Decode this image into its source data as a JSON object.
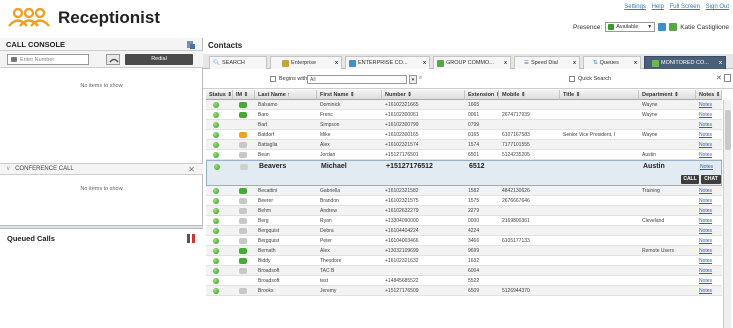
{
  "app": {
    "title": "Receptionist"
  },
  "header": {
    "links": [
      "Settings",
      "Help",
      "Full Screen",
      "Sign Out"
    ],
    "presence_label": "Presence:",
    "presence_value": "Available",
    "user_name": "Katie Castiglione"
  },
  "call_console": {
    "title": "CALL CONSOLE",
    "enter_number_placeholder": "Enter Number",
    "redial_label": "Redial",
    "no_items": "No items to show"
  },
  "conference": {
    "title": "CONFERENCE CALL",
    "no_items": "No items to show"
  },
  "queued": {
    "title": "Queued Calls"
  },
  "contacts": {
    "title": "Contacts",
    "tabs": [
      {
        "label": "SEARCH",
        "closable": false
      },
      {
        "label": "Enterprise",
        "closable": true
      },
      {
        "label": "ENTERPRISE CO...",
        "closable": true
      },
      {
        "label": "GROUP COMMO...",
        "closable": true
      },
      {
        "label": "Speed Dial",
        "closable": true
      },
      {
        "label": "Queues",
        "closable": true
      },
      {
        "label": "MONITORED CO...",
        "closable": true
      }
    ],
    "filter": {
      "begins_with_label": "Begins with",
      "field_value": "All",
      "quick_search_label": "Quick Search"
    },
    "columns": [
      "Status",
      "IM",
      "Last Name",
      "First Name",
      "Number",
      "Extension",
      "Mobile",
      "Title",
      "Department",
      "Notes"
    ],
    "rows": [
      {
        "last": "Balsamo",
        "first": "Dominick",
        "number": "+16102321665",
        "ext": "1665",
        "mobile": "",
        "title": "",
        "dept": "Wayne",
        "im": "green"
      },
      {
        "last": "Baro",
        "first": "Frenc",
        "number": "+16102300061",
        "ext": "0061",
        "mobile": "2674717939",
        "title": "",
        "dept": "Wayne",
        "im": "green"
      },
      {
        "last": "Bart",
        "first": "Simpson",
        "number": "+16102300799",
        "ext": "0799",
        "mobile": "",
        "title": "",
        "dept": "",
        "im": "none"
      },
      {
        "last": "Batdorf",
        "first": "Mike",
        "number": "+16102300165",
        "ext": "0165",
        "mobile": "6107167583",
        "title": "Senior Vice President, I",
        "dept": "Wayne",
        "im": "orange"
      },
      {
        "last": "Battaglia",
        "first": "Alex",
        "number": "+16102321574",
        "ext": "1574",
        "mobile": "7177101555",
        "title": "",
        "dept": "",
        "im": "gray"
      },
      {
        "last": "Bean",
        "first": "Jordan",
        "number": "+15127176501",
        "ext": "6501",
        "mobile": "5124235205",
        "title": "",
        "dept": "Austin",
        "im": "gray"
      },
      {
        "last": "Becattini",
        "first": "Gabriella",
        "number": "+16102321582",
        "ext": "1582",
        "mobile": "4842130626",
        "title": "",
        "dept": "Training",
        "im": "green"
      },
      {
        "last": "Beerer",
        "first": "Brandon",
        "number": "+16102321575",
        "ext": "1575",
        "mobile": "2676667646",
        "title": "",
        "dept": "",
        "im": "gray"
      },
      {
        "last": "Behm",
        "first": "Andrew",
        "number": "+16102632279",
        "ext": "2279",
        "mobile": "",
        "title": "",
        "dept": "",
        "im": "gray"
      },
      {
        "last": "Berg",
        "first": "Ryan",
        "number": "+13304090000",
        "ext": "0000",
        "mobile": "2169800361",
        "title": "",
        "dept": "Cleveland",
        "im": "gray"
      },
      {
        "last": "Bergquist",
        "first": "Debra",
        "number": "+16104404224",
        "ext": "4224",
        "mobile": "",
        "title": "",
        "dept": "",
        "im": "gray"
      },
      {
        "last": "Bergquist",
        "first": "Peter",
        "number": "+16104003466",
        "ext": "3466",
        "mobile": "6105177133",
        "title": "",
        "dept": "",
        "im": "gray"
      },
      {
        "last": "Bernath",
        "first": "Alex",
        "number": "+13032109699",
        "ext": "9699",
        "mobile": "",
        "title": "",
        "dept": "Remote Users",
        "im": "green"
      },
      {
        "last": "Biddy",
        "first": "Theodore",
        "number": "+16102321632",
        "ext": "1632",
        "mobile": "",
        "title": "",
        "dept": "",
        "im": "green"
      },
      {
        "last": "Broadsoft",
        "first": "TAC B",
        "number": "",
        "ext": "6004",
        "mobile": "",
        "title": "",
        "dept": "",
        "im": "gray"
      },
      {
        "last": "Broadsoft",
        "first": "test",
        "number": "+14845685522",
        "ext": "5522",
        "mobile": "",
        "title": "",
        "dept": "",
        "im": "none"
      },
      {
        "last": "Brooks",
        "first": "Jeremy",
        "number": "+15127176509",
        "ext": "6509",
        "mobile": "5126944370",
        "title": "",
        "dept": "",
        "im": "gray"
      }
    ],
    "selected": {
      "last": "Beavers",
      "first": "Michael",
      "number": "+15127176512",
      "ext": "6512",
      "dept": "Austin",
      "call_label": "CALL",
      "chat_label": "CHAT"
    },
    "notes_label": "Notes"
  },
  "colors": {
    "accent": "#4a5f78",
    "status_green": "#2f9a1f",
    "link": "#2f5fb0"
  }
}
